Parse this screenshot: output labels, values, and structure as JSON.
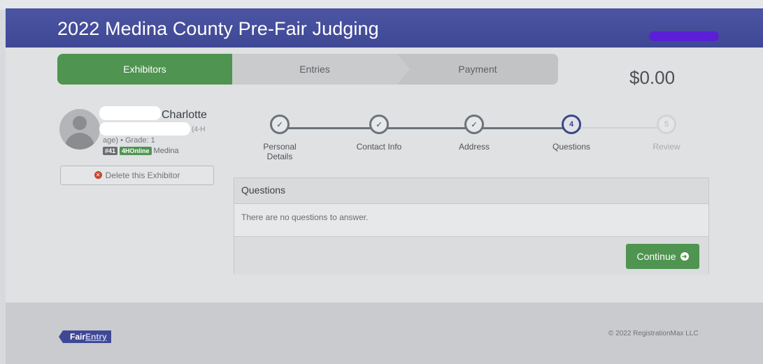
{
  "header": {
    "title": "2022 Medina County Pre-Fair Judging"
  },
  "steps": [
    "Exhibitors",
    "Entries",
    "Payment"
  ],
  "total": "$0.00",
  "exhibitor": {
    "name": "Charlotte",
    "age_hint": "(4-H",
    "grade_line": "age) • Grade: 1",
    "number_badge": "#41",
    "source_badge": "4HOnline",
    "county": "Medina",
    "delete_label": "Delete this Exhibitor"
  },
  "wizard": [
    {
      "num": "✓",
      "label": "Personal Details",
      "state": "done"
    },
    {
      "num": "✓",
      "label": "Contact Info",
      "state": "done"
    },
    {
      "num": "✓",
      "label": "Address",
      "state": "done"
    },
    {
      "num": "4",
      "label": "Questions",
      "state": "active"
    },
    {
      "num": "5",
      "label": "Review",
      "state": "todo"
    }
  ],
  "questions": {
    "title": "Questions",
    "empty_text": "There are no questions to answer.",
    "continue_label": "Continue"
  },
  "footer": {
    "brand_fair": "Fair",
    "brand_entry": "Entry",
    "copyright": "© 2022 RegistrationMax LLC"
  }
}
